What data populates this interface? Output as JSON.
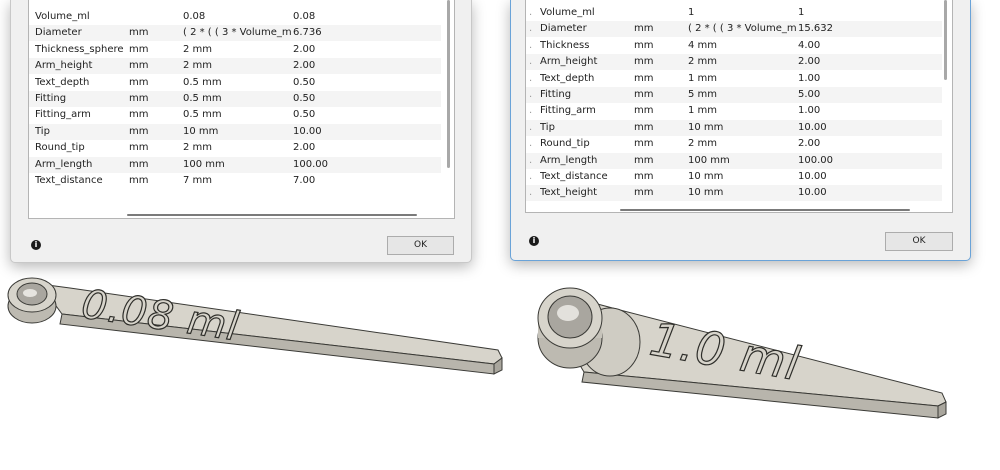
{
  "left": {
    "rows": [
      {
        "name": "Volume_ml",
        "unit": "",
        "expr": "0.08",
        "value": "0.08"
      },
      {
        "name": "Diameter",
        "unit": "mm",
        "expr": "( 2 * ( ( 3 * Volume_ml...",
        "value": "6.736"
      },
      {
        "name": "Thickness_sphere",
        "unit": "mm",
        "expr": "2 mm",
        "value": "2.00"
      },
      {
        "name": "Arm_height",
        "unit": "mm",
        "expr": "2 mm",
        "value": "2.00"
      },
      {
        "name": "Text_depth",
        "unit": "mm",
        "expr": "0.5 mm",
        "value": "0.50"
      },
      {
        "name": "Fitting",
        "unit": "mm",
        "expr": "0.5 mm",
        "value": "0.50"
      },
      {
        "name": "Fitting_arm",
        "unit": "mm",
        "expr": "0.5 mm",
        "value": "0.50"
      },
      {
        "name": "Tip",
        "unit": "mm",
        "expr": "10 mm",
        "value": "10.00"
      },
      {
        "name": "Round_tip",
        "unit": "mm",
        "expr": "2 mm",
        "value": "2.00"
      },
      {
        "name": "Arm_length",
        "unit": "mm",
        "expr": "100 mm",
        "value": "100.00"
      },
      {
        "name": "Text_distance",
        "unit": "mm",
        "expr": "7 mm",
        "value": "7.00"
      }
    ],
    "ok_label": "OK",
    "info_glyph": "i",
    "model_text": "0.08 ml"
  },
  "right": {
    "tick_glyph": ".",
    "rows": [
      {
        "name": "Volume_ml",
        "unit": "",
        "expr": "1",
        "value": "1"
      },
      {
        "name": "Diameter",
        "unit": "mm",
        "expr": "( 2 * ( ( 3 * Volume_ml...",
        "value": "15.632"
      },
      {
        "name": "Thickness",
        "unit": "mm",
        "expr": "4 mm",
        "value": "4.00"
      },
      {
        "name": "Arm_height",
        "unit": "mm",
        "expr": "2 mm",
        "value": "2.00"
      },
      {
        "name": "Text_depth",
        "unit": "mm",
        "expr": "1 mm",
        "value": "1.00"
      },
      {
        "name": "Fitting",
        "unit": "mm",
        "expr": "5 mm",
        "value": "5.00"
      },
      {
        "name": "Fitting_arm",
        "unit": "mm",
        "expr": "1 mm",
        "value": "1.00"
      },
      {
        "name": "Tip",
        "unit": "mm",
        "expr": "10 mm",
        "value": "10.00"
      },
      {
        "name": "Round_tip",
        "unit": "mm",
        "expr": "2 mm",
        "value": "2.00"
      },
      {
        "name": "Arm_length",
        "unit": "mm",
        "expr": "100 mm",
        "value": "100.00"
      },
      {
        "name": "Text_distance",
        "unit": "mm",
        "expr": "10 mm",
        "value": "10.00"
      },
      {
        "name": "Text_height",
        "unit": "mm",
        "expr": "10 mm",
        "value": "10.00"
      }
    ],
    "ok_label": "OK",
    "info_glyph": "i",
    "model_text": "1.0 ml"
  },
  "colors": {
    "dialog_bg": "#f0f0f0",
    "table_bg": "#ffffff",
    "model_body": "#d7d4cb",
    "model_edge": "#3a3a36",
    "active_border": "#6aa3d8"
  },
  "icons": [
    "info-icon"
  ]
}
